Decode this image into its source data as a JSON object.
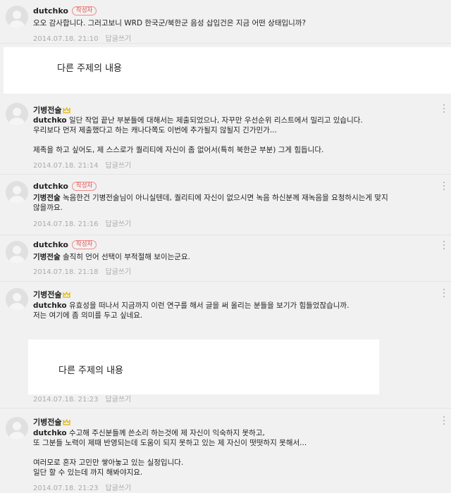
{
  "author_badge": "작성자",
  "reply_label": "답글쓰기",
  "other_topic": "다른 주제의 내용",
  "comments": [
    {
      "author": "dutchko",
      "is_author": true,
      "lines": [
        "오오 감사합니다. 그러고보니 WRD 한국군/북한군 음성 삽입건은 지금 어떤 상태입니까?"
      ],
      "date": "2014.07.18. 21:10"
    },
    {
      "author": "기병전술",
      "is_author": false,
      "mention": "dutchko",
      "lines": [
        " 일단 작업 끝난 부분들에 대해서는 제출되었으나, 자꾸만 우선순위 리스트에서 밀리고 있습니다.",
        "우리보다 먼저 제출했다고 하는 캐나다쪽도 이번에 추가될지 않될지 긴가민가...",
        "",
        "제족을 하고 싶어도, 제 스스로가 퀄리티에 자신이 좀 없어서(특히 북한군 부분) 그게 힘듭니다."
      ],
      "date": "2014.07.18. 21:14"
    },
    {
      "author": "dutchko",
      "is_author": true,
      "mention": "기병전술",
      "lines": [
        " 녹음한건 기병전술님이 아니실텐데, 퀄리티에 자신이 없으시면 녹음 하신분께 재녹음을 요청하시는게 맞지",
        "않을까요."
      ],
      "date": "2014.07.18. 21:16"
    },
    {
      "author": "dutchko",
      "is_author": true,
      "mention": "기병전술",
      "lines": [
        " 솔직히 언어 선택이 부적절해 보이는군요."
      ],
      "date": "2014.07.18. 21:18"
    },
    {
      "author": "기병전술",
      "is_author": false,
      "mention": "dutchko",
      "lines": [
        " 유효성을 떠나서 지금까지 이런 연구를 해서 글을 써 올리는 분들을 보기가 힘들었잖습니까.",
        "저는 여기에 좀 의미를 두고 싶네요."
      ],
      "date": "2014.07.18. 21:23"
    },
    {
      "author": "기병전술",
      "is_author": false,
      "mention": "dutchko",
      "lines": [
        " 수고해 주신분들께 쓴소리 하는것에 제 자신이 익숙하지 못하고,",
        "또 그분들 노력이 제때 반영되는데 도움이 되지 못하고 있는 제 자신이 떳떳하지 못해서...",
        "",
        "여러모로 혼자 고민만 쌓아놓고 있는 실정입니다.",
        "일단 할 수 있는데 까지 해봐야지요."
      ],
      "date": "2014.07.18. 21:23"
    }
  ]
}
